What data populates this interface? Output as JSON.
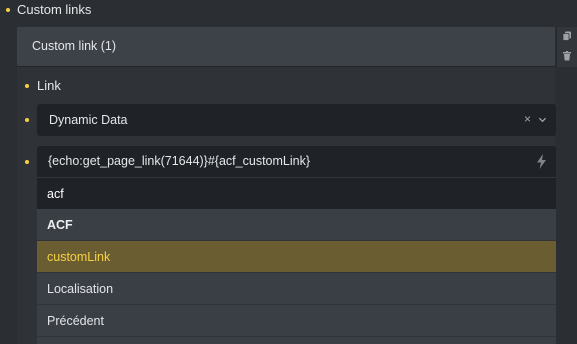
{
  "section": {
    "title": "Custom links"
  },
  "repeater": {
    "item_title": "Custom link (1)",
    "actions": [
      "copy-icon",
      "trash-icon"
    ]
  },
  "field": {
    "label": "Link"
  },
  "select": {
    "value": "Dynamic Data",
    "clear": "×"
  },
  "link_input": {
    "value": "{echo:get_page_link(71644)}#{acf_customLink}"
  },
  "search": {
    "value": "acf"
  },
  "dropdown": {
    "group": "ACF",
    "options": [
      "customLink",
      "Localisation",
      "Précédent"
    ],
    "selected": "customLink"
  },
  "colors": {
    "accent": "#f5d142",
    "selected_bg": "#6b5d32",
    "input_bg": "#1f2226"
  }
}
